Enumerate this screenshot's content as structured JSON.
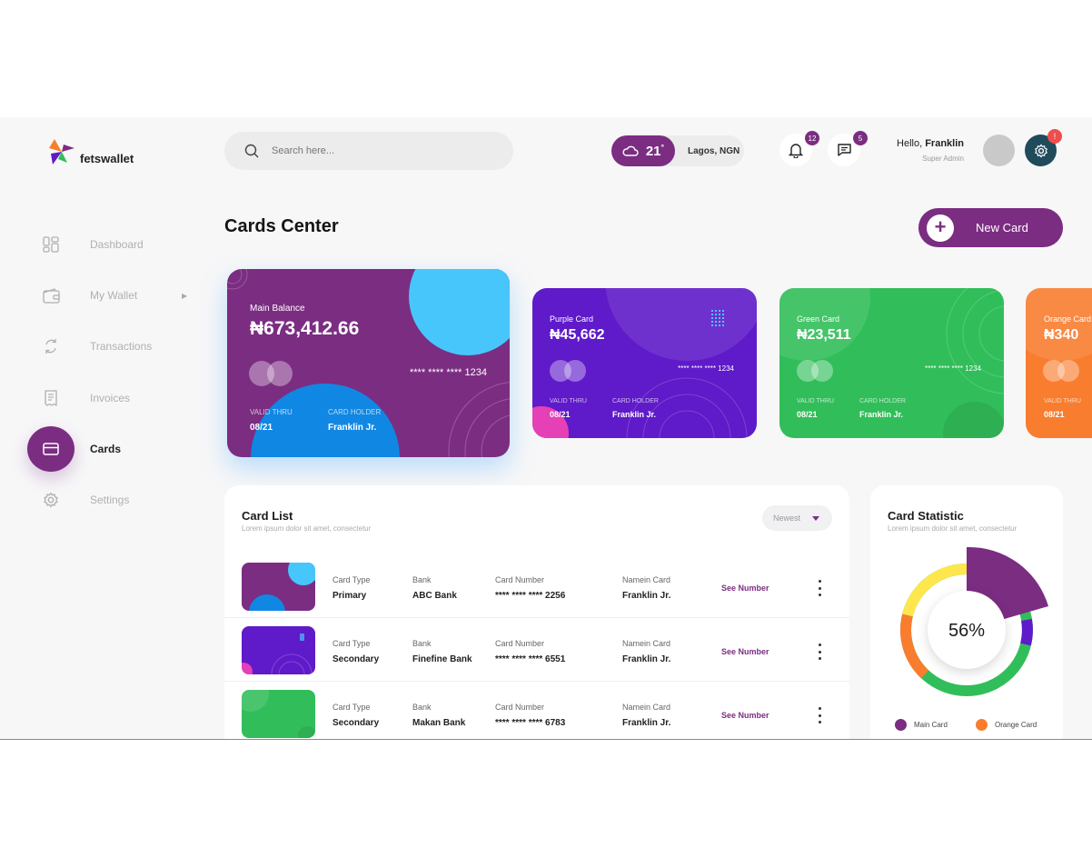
{
  "brand": {
    "name": "fetswallet"
  },
  "search": {
    "placeholder": "Search here..."
  },
  "weather": {
    "temperature": "21",
    "degree": "°",
    "location": "Lagos, NGN"
  },
  "notifications": {
    "count": "12"
  },
  "messages": {
    "count": "5"
  },
  "user": {
    "greeting": "Hello, ",
    "name": "Franklin",
    "role": "Super Admin"
  },
  "settings": {
    "alert": "!"
  },
  "sidebar": {
    "items": [
      {
        "label": "Dashboard",
        "icon": "dashboard-icon"
      },
      {
        "label": "My Wallet",
        "icon": "wallet-icon"
      },
      {
        "label": "Transactions",
        "icon": "transactions-icon"
      },
      {
        "label": "Invoices",
        "icon": "invoice-icon"
      },
      {
        "label": "Cards",
        "icon": "card-icon",
        "active": true
      },
      {
        "label": "Settings",
        "icon": "gear-icon"
      }
    ]
  },
  "page": {
    "title": "Cards Center",
    "new_card_label": "New Card"
  },
  "cards": [
    {
      "title": "Main Balance",
      "amount": "₦673,412.66",
      "number": "**** **** **** 1234",
      "valid_label": "VALID THRU",
      "valid": "08/21",
      "holder_label": "CARD HOLDER",
      "holder": "Franklin Jr.",
      "color": "#7b2d82"
    },
    {
      "title": "Purple Card",
      "amount": "₦45,662",
      "number": "**** **** **** 1234",
      "valid_label": "VALID THRU",
      "valid": "08/21",
      "holder_label": "CARD HOLDER",
      "holder": "Franklin Jr.",
      "color": "#5f1ac9"
    },
    {
      "title": "Green Card",
      "amount": "₦23,511",
      "number": "**** **** **** 1234",
      "valid_label": "VALID THRU",
      "valid": "08/21",
      "holder_label": "CARD HOLDER",
      "holder": "Franklin Jr.",
      "color": "#31be5a"
    },
    {
      "title": "Orange Card",
      "amount": "₦340",
      "valid_label": "VALID THRU",
      "valid": "08/21",
      "color": "#f97d2f"
    }
  ],
  "card_list": {
    "title": "Card List",
    "subtitle": "Lorem ipsum dolor sit amet, consectetur",
    "sort": "Newest",
    "headers": {
      "type": "Card Type",
      "bank": "Bank",
      "number": "Card Number",
      "name": "Namein Card"
    },
    "see_number": "See Number",
    "rows": [
      {
        "type": "Primary",
        "bank": "ABC Bank",
        "number": "**** **** **** 2256",
        "name": "Franklin Jr."
      },
      {
        "type": "Secondary",
        "bank": "Finefine Bank",
        "number": "**** **** **** 6551",
        "name": "Franklin Jr."
      },
      {
        "type": "Secondary",
        "bank": "Makan Bank",
        "number": "**** **** **** 6783",
        "name": "Franklin Jr."
      }
    ]
  },
  "card_statistic": {
    "title": "Card Statistic",
    "subtitle": "Lorem ipsum dolor sit amet, consectetur",
    "percent": "56%",
    "legend": [
      {
        "label": "Main Card",
        "color": "#7b2d82"
      },
      {
        "label": "Orange Card",
        "color": "#f97d2f"
      }
    ]
  }
}
